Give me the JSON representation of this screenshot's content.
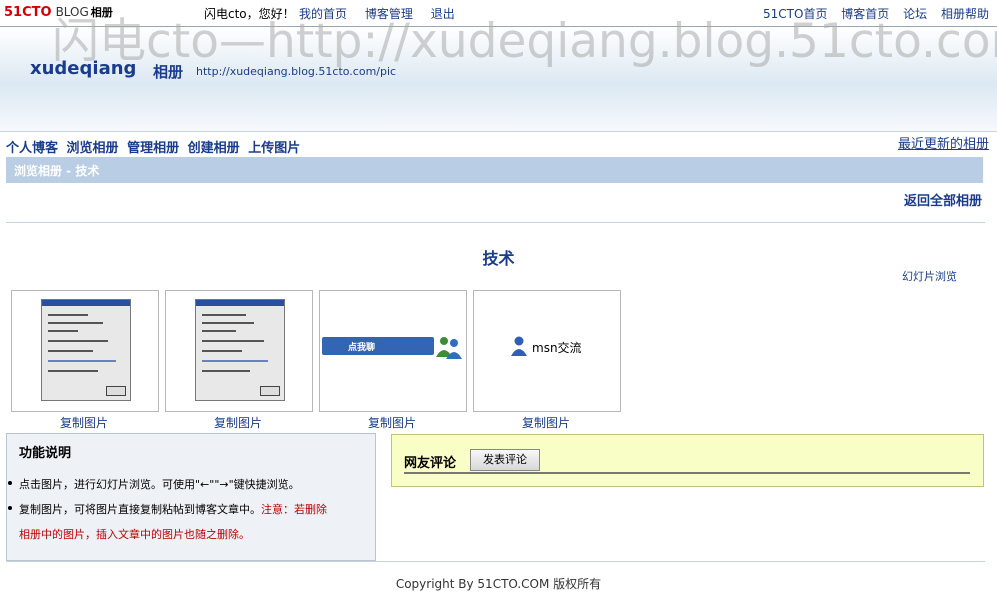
{
  "watermark": "闪电cto—http://xudeqiang.blog.51cto.com",
  "topbar": {
    "logo_51": "51CTO",
    "logo_blog": "BLOG",
    "logo_album": "相册",
    "greeting": "闪电cto，您好！",
    "left_links": [
      "我的首页",
      "博客管理",
      "退出"
    ],
    "right_links": [
      "51CTO首页",
      "博客首页",
      "论坛",
      "相册帮助"
    ]
  },
  "header": {
    "blog_name": "xudeqiang",
    "album_word": "相册",
    "url": "http://xudeqiang.blog.51cto.com/pic"
  },
  "menu": {
    "items": [
      "个人博客",
      "浏览相册",
      "管理相册",
      "创建相册",
      "上传图片"
    ],
    "recent": "最近更新的相册"
  },
  "breadcrumb": "浏览相册 - 技术",
  "back_all": "返回全部相册",
  "album": {
    "title": "技术",
    "slideshow": "幻灯片浏览",
    "photos": [
      {
        "kind": "dialog-screenshot",
        "copy_label": "复制图片"
      },
      {
        "kind": "dialog-screenshot",
        "copy_label": "复制图片"
      },
      {
        "kind": "chat-banner",
        "text": "点我聊",
        "copy_label": "复制图片"
      },
      {
        "kind": "msn-icon",
        "text": "msn交流",
        "copy_label": "复制图片"
      }
    ]
  },
  "help": {
    "title": "功能说明",
    "line1": "点击图片，进行幻灯片浏览。可使用\"←\"\"→\"键快捷浏览。",
    "line2_plain": "复制图片，可将图片直接复制粘帖到博客文章中。",
    "line2_warn": "注意：若删除",
    "line3_warn": "相册中的图片，插入文章中的图片也随之删除。"
  },
  "comments": {
    "label": "网友评论",
    "button": "发表评论"
  },
  "footer": "Copyright By 51CTO.COM 版权所有",
  "colors": {
    "link": "#1a3c8c",
    "crumb_bg": "#b9cde4",
    "comment_bg": "#f9fdc6",
    "warning": "#c00000"
  }
}
